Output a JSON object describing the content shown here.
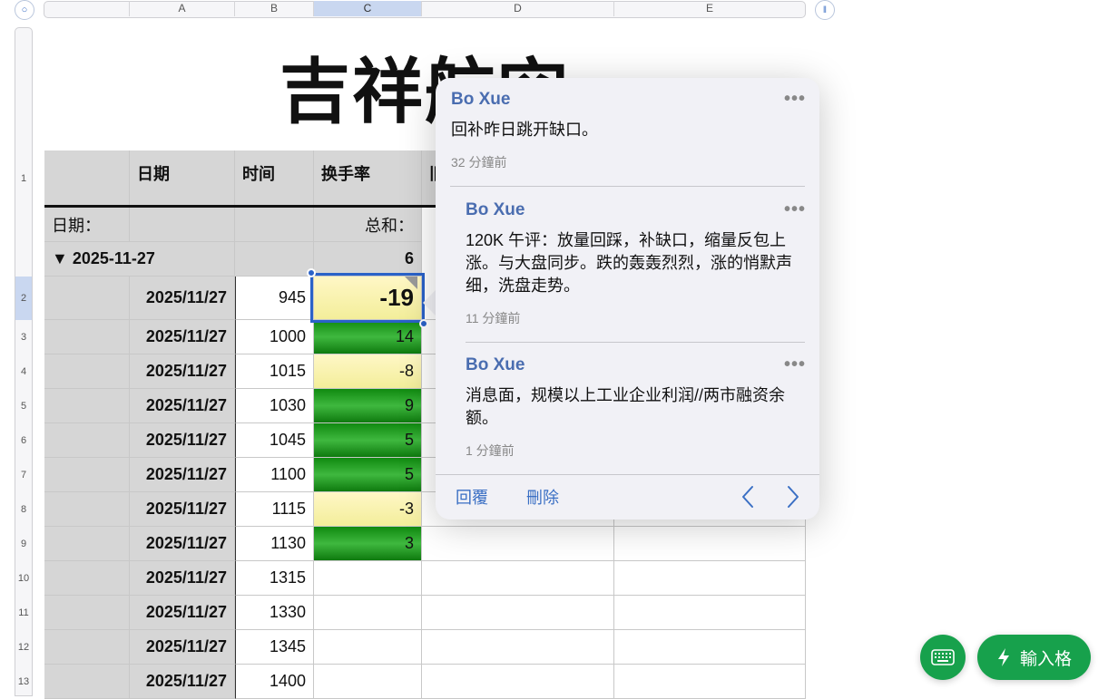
{
  "sheet": {
    "columns": [
      "A",
      "B",
      "C",
      "D",
      "E"
    ],
    "selected_column": "C",
    "title": "吉祥航空",
    "header_row": {
      "row_num": "1",
      "cols": [
        "",
        "日期",
        "时间",
        "换手率",
        "旧"
      ]
    },
    "group_label_row": {
      "label": "日期：",
      "sum_label": "总和："
    },
    "group_row": {
      "label": "▼ 2025-11-27",
      "sum_value": "6"
    },
    "rows": [
      {
        "num": "2",
        "date": "2025/11/27",
        "time": "945",
        "value": "-19",
        "color": "yellow"
      },
      {
        "num": "3",
        "date": "2025/11/27",
        "time": "1000",
        "value": "14",
        "color": "green"
      },
      {
        "num": "4",
        "date": "2025/11/27",
        "time": "1015",
        "value": "-8",
        "color": "yellow"
      },
      {
        "num": "5",
        "date": "2025/11/27",
        "time": "1030",
        "value": "9",
        "color": "green"
      },
      {
        "num": "6",
        "date": "2025/11/27",
        "time": "1045",
        "value": "5",
        "color": "green"
      },
      {
        "num": "7",
        "date": "2025/11/27",
        "time": "1100",
        "value": "5",
        "color": "green"
      },
      {
        "num": "8",
        "date": "2025/11/27",
        "time": "1115",
        "value": "-3",
        "color": "yellow"
      },
      {
        "num": "9",
        "date": "2025/11/27",
        "time": "1130",
        "value": "3",
        "color": "green"
      },
      {
        "num": "10",
        "date": "2025/11/27",
        "time": "1315",
        "value": "",
        "color": "none"
      },
      {
        "num": "11",
        "date": "2025/11/27",
        "time": "1330",
        "value": "",
        "color": "none"
      },
      {
        "num": "12",
        "date": "2025/11/27",
        "time": "1345",
        "value": "",
        "color": "none"
      },
      {
        "num": "13",
        "date": "2025/11/27",
        "time": "1400",
        "value": "",
        "color": "none"
      }
    ]
  },
  "comments": {
    "items": [
      {
        "author": "Bo Xue",
        "text": "回补昨日跳开缺口。",
        "time": "32 分鐘前"
      },
      {
        "author": "Bo Xue",
        "text": "120K 午评：放量回踩，补缺口，缩量反包上涨。与大盘同步。跌的轰轰烈烈，涨的悄默声细，洗盘走势。",
        "time": "11 分鐘前"
      },
      {
        "author": "Bo Xue",
        "text": "消息面，规模以上工业企业利润//两市融资余额。",
        "time": "1 分鐘前"
      }
    ],
    "more_icon": "•••",
    "reply_label": "回覆",
    "delete_label": "刪除",
    "prev_icon": "chevron-left-icon",
    "next_icon": "chevron-right-icon"
  },
  "fab": {
    "keyboard_icon": "keyboard-icon",
    "input_label": "輸入格",
    "input_icon": "bolt-icon"
  },
  "colors": {
    "accent": "#3a6fc4",
    "fab": "#17a14c",
    "green": "#1a9a1a",
    "yellow": "#f6f0a6",
    "header_grey": "#d6d6d6"
  }
}
